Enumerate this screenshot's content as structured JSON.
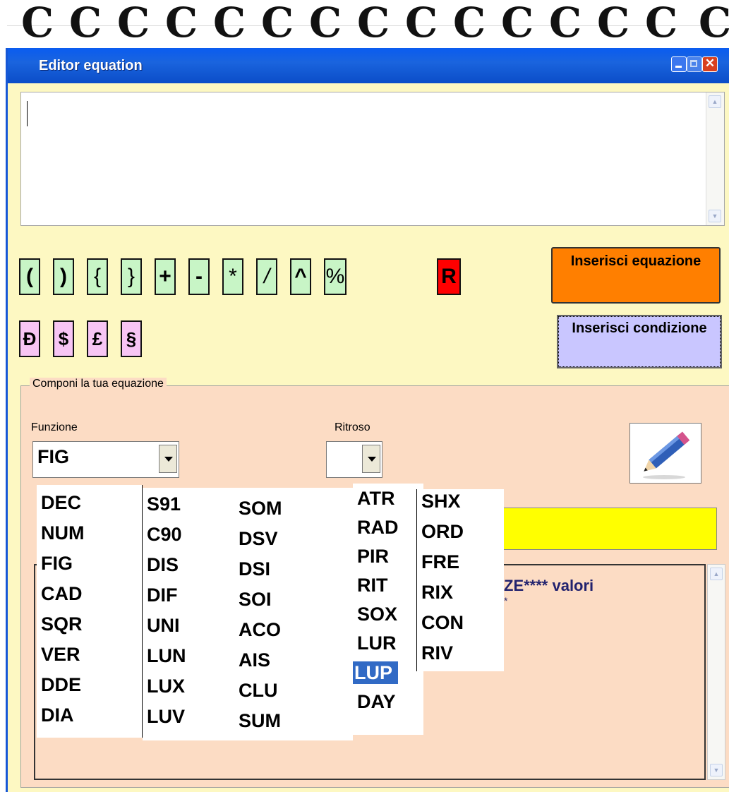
{
  "window": {
    "title": "Editor equation"
  },
  "operators": {
    "row1": [
      "(",
      ")",
      "{",
      "}",
      "+",
      "-",
      "*",
      "/",
      "^",
      "%"
    ],
    "r_button": "R",
    "row2": [
      "Ð",
      "$",
      "£",
      "§"
    ]
  },
  "buttons": {
    "insert_equation": "Inserisci equazione",
    "insert_condition": "Inserisci condizione"
  },
  "group": {
    "title": "Componi la tua equazione",
    "function_label": "Funzione",
    "function_value": "FIG",
    "ritroso_label": "Ritroso",
    "ritroso_value": ""
  },
  "function_list": {
    "col1": [
      "DEC",
      "NUM",
      "FIG",
      "CAD",
      "SQR",
      "VER",
      "DDE",
      "DIA"
    ],
    "col2": [
      "S91",
      "C90",
      "DIS",
      "DIF",
      "UNI",
      "LUN",
      "LUX",
      "LUV"
    ],
    "col3": [
      "SOM",
      "DSV",
      "DSI",
      "SOI",
      "ACO",
      "AIS",
      "CLU",
      "SUM"
    ],
    "col4": [
      "ATR",
      "RAD",
      "PIR",
      "RIT",
      "SOX",
      "LUR",
      "LUP",
      "DAY"
    ],
    "col5": [
      "SHX",
      "ORD",
      "FRE",
      "RIX",
      "CON",
      "RIV"
    ],
    "selected": "LUP"
  },
  "result": {
    "text": "ZE**** valori",
    "dots": "*"
  },
  "icons": {
    "pencil": "pencil-icon",
    "ring": "spiral-ring-icon"
  },
  "colors": {
    "window_bg": "#fdf8c2",
    "group_bg": "#fcdcc4",
    "operator_green": "#c8f5c6",
    "operator_pink": "#f7c5f4",
    "operator_red": "#ff0000",
    "insert_equation_bg": "#ff7f00",
    "insert_condition_bg": "#c9c6ff",
    "highlight": "#ffff00",
    "selection": "#316ac5"
  }
}
